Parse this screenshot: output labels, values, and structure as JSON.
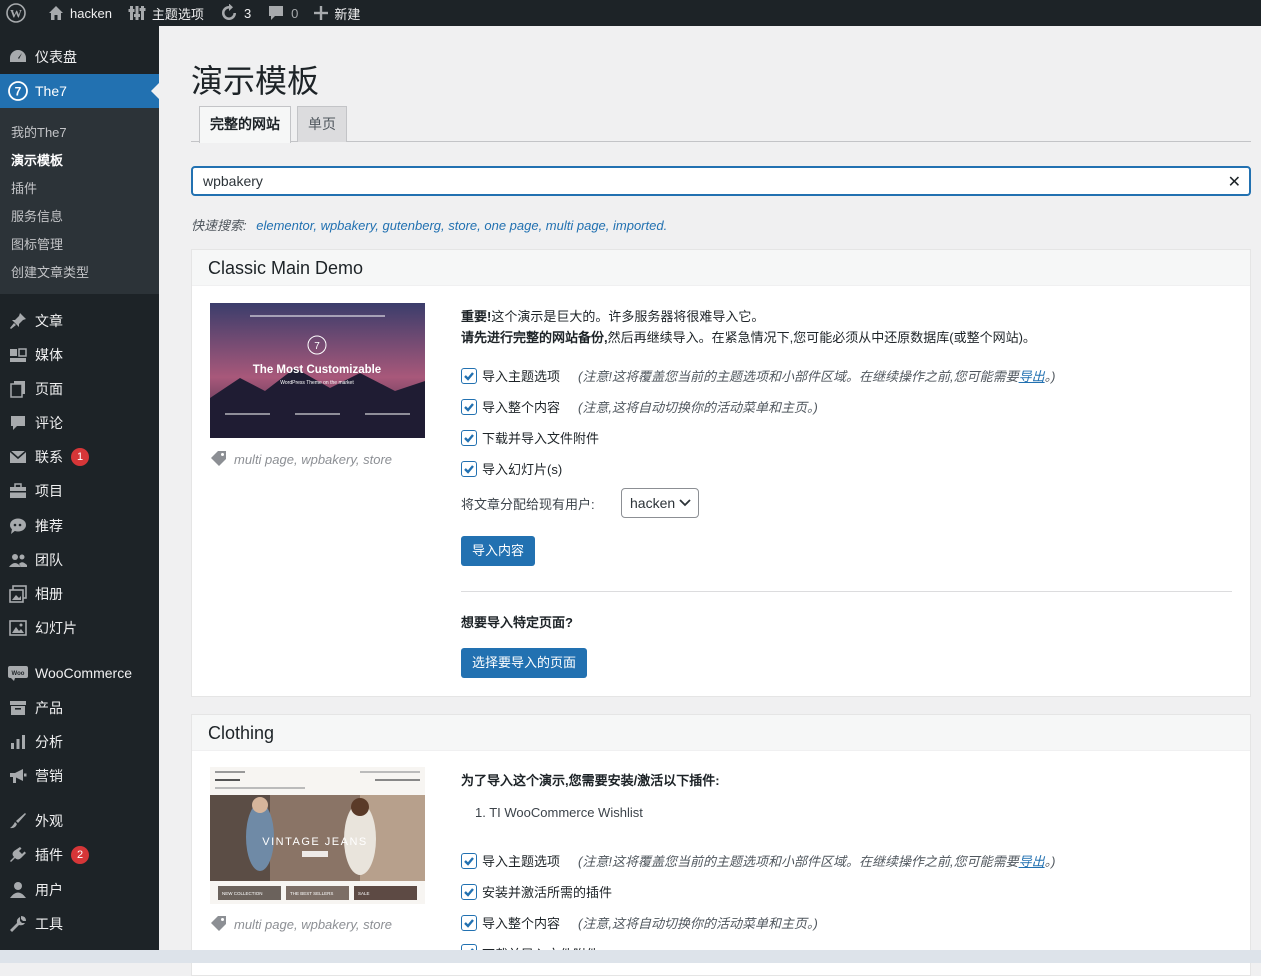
{
  "adminbar": {
    "site_name": "hacken",
    "theme_options": "主题选项",
    "updates_count": "3",
    "comments_count": "0",
    "new_label": "新建"
  },
  "sidebar": {
    "dashboard": "仪表盘",
    "the7": "The7",
    "sub_items": [
      "我的The7",
      "演示模板",
      "插件",
      "服务信息",
      "图标管理",
      "创建文章类型"
    ],
    "posts": "文章",
    "media": "媒体",
    "pages": "页面",
    "comments": "评论",
    "contact": "联系",
    "contact_badge": "1",
    "projects": "项目",
    "testimonials": "推荐",
    "team": "团队",
    "albums": "相册",
    "slideshows": "幻灯片",
    "woocommerce": "WooCommerce",
    "products": "产品",
    "analytics": "分析",
    "marketing": "营销",
    "appearance": "外观",
    "plugins": "插件",
    "plugins_badge": "2",
    "users": "用户",
    "tools": "工具"
  },
  "page": {
    "title": "演示模板",
    "tabs": [
      "完整的网站",
      "单页"
    ],
    "search_value": "wpbakery",
    "quick_search_label": "快速搜索:",
    "quick_search_links": "elementor, wpbakery, gutenberg, store, one page, multi page, imported."
  },
  "demo1": {
    "title": "Classic Main Demo",
    "thumb_headline": "The Most Customizable",
    "thumb_sub": "WordPress Theme on the market",
    "thumb_logo": "7",
    "tags": "multi page, wpbakery, store",
    "warn_bold": "重要!",
    "warn_text": "这个演示是巨大的。许多服务器将很难导入它。",
    "warn2_bold": "请先进行完整的网站备份,",
    "warn2_text": "然后再继续导入。在紧急情况下,您可能必须从中还原数据库(或整个网站)。",
    "opt1": "导入主题选项",
    "opt1_note": "(注意!这将覆盖您当前的主题选项和小部件区域。在继续操作之前,您可能需要",
    "opt1_link": "导出",
    "opt1_end": "。)",
    "opt2": "导入整个内容",
    "opt2_note": "(注意,这将自动切换你的活动菜单和主页。)",
    "opt3": "下载并导入文件附件",
    "opt4": "导入幻灯片(s)",
    "assign_label": "将文章分配给现有用户:",
    "assign_value": "hacken",
    "import_btn": "导入内容",
    "specific_heading": "想要导入特定页面?",
    "select_pages_btn": "选择要导入的页面"
  },
  "demo2": {
    "title": "Clothing",
    "thumb_text": "VINTAGE JEANS",
    "thumb_captions": [
      "NEW COLLECTION",
      "THE BEST SELLERS",
      "SALE"
    ],
    "tags": "multi page, wpbakery, store",
    "plugins_heading": "为了导入这个演示,您需要安装/激活以下插件:",
    "plugin_item": "1. TI WooCommerce Wishlist",
    "opt1": "导入主题选项",
    "opt1_note": "(注意!这将覆盖您当前的主题选项和小部件区域。在继续操作之前,您可能需要",
    "opt1_link": "导出",
    "opt1_end": "。)",
    "opt_plugins": "安装并激活所需的插件",
    "opt2": "导入整个内容",
    "opt2_note": "(注意,这将自动切换你的活动菜单和主页。)",
    "opt3": "下载并导入文件附件"
  },
  "colors": {
    "admin_dark": "#1d2327",
    "accent": "#2271b1",
    "badge": "#d63638"
  }
}
